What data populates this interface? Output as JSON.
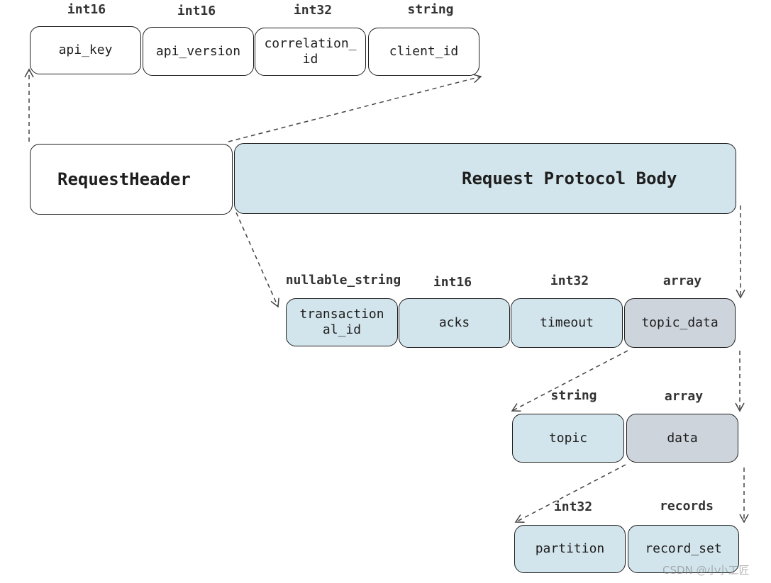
{
  "header_fields": [
    {
      "type": "int16",
      "name": "api_key"
    },
    {
      "type": "int16",
      "name": "api_version"
    },
    {
      "type": "int32",
      "name": "correlation_\nid"
    },
    {
      "type": "string",
      "name": "client_id"
    }
  ],
  "request_header": "RequestHeader",
  "request_body": "Request Protocol Body",
  "body_fields": [
    {
      "type": "nullable_string",
      "name": "transaction\nal_id"
    },
    {
      "type": "int16",
      "name": "acks"
    },
    {
      "type": "int32",
      "name": "timeout"
    },
    {
      "type": "array",
      "name": "topic_data"
    }
  ],
  "topic_data_fields": [
    {
      "type": "string",
      "name": "topic"
    },
    {
      "type": "array",
      "name": "data"
    }
  ],
  "data_fields": [
    {
      "type": "int32",
      "name": "partition"
    },
    {
      "type": "records",
      "name": "record_set"
    }
  ],
  "colors": {
    "field": "#d3e5ec",
    "array": "#ced4dc",
    "stroke": "#1e1e1e"
  },
  "watermark": "CSDN @小小工匠"
}
